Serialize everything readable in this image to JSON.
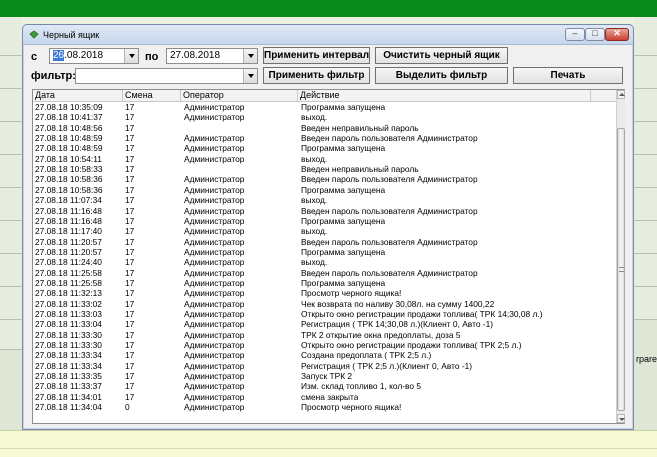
{
  "window": {
    "title": "Черный ящик",
    "min_label": "–",
    "max_label": "□",
    "close_label": "✕"
  },
  "filter": {
    "from_label": "с",
    "from_date_selected": "26",
    "from_date_rest": ".08.2018",
    "to_label": "по",
    "to_date": "27.08.2018",
    "filter_label": "фильтр:",
    "filter_value": ""
  },
  "buttons": {
    "apply_interval": "Применить интервал",
    "clear_box": "Очистить черный ящик",
    "apply_filter": "Применить фильтр",
    "select_filter": "Выделить фильтр",
    "print": "Печать"
  },
  "table": {
    "columns": [
      "Дата",
      "Смена",
      "Оператор",
      "Действие"
    ],
    "rows": [
      {
        "date": "27.08.18 10:35:09",
        "shift": "17",
        "operator": "Администратор",
        "action": "Программа запущена"
      },
      {
        "date": "27.08.18 10:41:37",
        "shift": "17",
        "operator": "Администратор",
        "action": " выход."
      },
      {
        "date": "27.08.18 10:48:56",
        "shift": "17",
        "operator": "",
        "action": "Введен неправильный пароль",
        "operator_blurred": true
      },
      {
        "date": "27.08.18 10:48:59",
        "shift": "17",
        "operator": "Администратор",
        "action": "Введен пароль пользователя Администратор"
      },
      {
        "date": "27.08.18 10:48:59",
        "shift": "17",
        "operator": "Администратор",
        "action": "Программа запущена"
      },
      {
        "date": "27.08.18 10:54:11",
        "shift": "17",
        "operator": "Администратор",
        "action": " выход."
      },
      {
        "date": "27.08.18 10:58:33",
        "shift": "17",
        "operator": "",
        "action": "Введен неправильный пароль",
        "operator_blurred": true
      },
      {
        "date": "27.08.18 10:58:36",
        "shift": "17",
        "operator": "Администратор",
        "action": "Введен пароль пользователя Администратор"
      },
      {
        "date": "27.08.18 10:58:36",
        "shift": "17",
        "operator": "Администратор",
        "action": "Программа запущена"
      },
      {
        "date": "27.08.18 11:07:34",
        "shift": "17",
        "operator": "Администратор",
        "action": " выход."
      },
      {
        "date": "27.08.18 11:16:48",
        "shift": "17",
        "operator": "Администратор",
        "action": "Введен пароль пользователя Администратор"
      },
      {
        "date": "27.08.18 11:16:48",
        "shift": "17",
        "operator": "Администратор",
        "action": "Программа запущена"
      },
      {
        "date": "27.08.18 11:17:40",
        "shift": "17",
        "operator": "Администратор",
        "action": " выход."
      },
      {
        "date": "27.08.18 11:20:57",
        "shift": "17",
        "operator": "Администратор",
        "action": "Введен пароль пользователя Администратор"
      },
      {
        "date": "27.08.18 11:20:57",
        "shift": "17",
        "operator": "Администратор",
        "action": "Программа запущена"
      },
      {
        "date": "27.08.18 11:24:40",
        "shift": "17",
        "operator": "Администратор",
        "action": " выход."
      },
      {
        "date": "27.08.18 11:25:58",
        "shift": "17",
        "operator": "Администратор",
        "action": "Введен пароль пользователя Администратор"
      },
      {
        "date": "27.08.18 11:25:58",
        "shift": "17",
        "operator": "Администратор",
        "action": "Программа запущена"
      },
      {
        "date": "27.08.18 11:32:13",
        "shift": "17",
        "operator": "Администратор",
        "action": "Просмотр черного ящика!"
      },
      {
        "date": "27.08.18 11:33:02",
        "shift": "17",
        "operator": "Администратор",
        "action": "Чек возврата по наливу 30,08л. на сумму 1400,22"
      },
      {
        "date": "27.08.18 11:33:03",
        "shift": "17",
        "operator": "Администратор",
        "action": "Открыто окно регистрации продажи топлива( ТРК 14;30,08 л.)"
      },
      {
        "date": "27.08.18 11:33:04",
        "shift": "17",
        "operator": "Администратор",
        "action": "Регистрация ( ТРК 14;30,08 л.)(Клиент 0, Авто -1)"
      },
      {
        "date": "27.08.18 11:33:30",
        "shift": "17",
        "operator": "Администратор",
        "action": "ТРК 2 открытие окна предоплаты, доза 5"
      },
      {
        "date": "27.08.18 11:33:30",
        "shift": "17",
        "operator": "Администратор",
        "action": "Открыто окно регистрации продажи топлива( ТРК 2;5 л.)"
      },
      {
        "date": "27.08.18 11:33:34",
        "shift": "17",
        "operator": "Администратор",
        "action": "Создана предоплата ( ТРК 2;5 л.)"
      },
      {
        "date": "27.08.18 11:33:34",
        "shift": "17",
        "operator": "Администратор",
        "action": "Регистрация ( ТРК 2;5 л.)(Клиент 0, Авто -1)"
      },
      {
        "date": "27.08.18 11:33:35",
        "shift": "17",
        "operator": "Администратор",
        "action": "Запуск ТРК 2"
      },
      {
        "date": "27.08.18 11:33:37",
        "shift": "17",
        "operator": "Администратор",
        "action": "Изм. склад топливо 1, кол-во 5"
      },
      {
        "date": "27.08.18 11:34:01",
        "shift": "17",
        "operator": "Администратор",
        "action": "смена закрыта"
      },
      {
        "date": "27.08.18 11:34:04",
        "shift": "0",
        "operator": "Администратор",
        "action": "Просмотр черного ящика!"
      }
    ]
  },
  "background": {
    "right_fragment": "rpare"
  },
  "colors": {
    "top_bar": "#0a8a1a",
    "selection": "#3a78d4",
    "bottom_area": "#f6f9d6"
  }
}
